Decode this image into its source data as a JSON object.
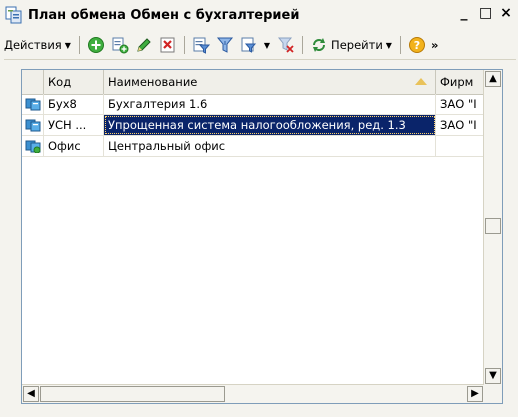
{
  "window": {
    "title": "План обмена Обмен с бухгалтерией",
    "icon": "exchange-plan-icon",
    "controls": {
      "minimize": "_",
      "maximize": "□",
      "close": "×"
    }
  },
  "toolbar": {
    "actions_label": "Действия",
    "goto_label": "Перейти",
    "more_label": "»",
    "icons": [
      "add-icon",
      "copy-icon",
      "edit-icon",
      "delete-icon",
      "filter-icon",
      "filter-by-value-icon",
      "filter-dropdown-icon",
      "clear-filter-icon",
      "refresh-icon",
      "help-icon"
    ]
  },
  "grid": {
    "columns": [
      "Код",
      "Наименование",
      "Фирм"
    ],
    "rows": [
      {
        "code": "Бух8",
        "name": "Бухгалтерия 1.6",
        "firm": "ЗАО \"I",
        "selected": false
      },
      {
        "code": "УСН ...",
        "name": "Упрощенная система налогообложения, ред. 1.3",
        "firm": "ЗАО \"I",
        "selected": true
      },
      {
        "code": "Офис",
        "name": "Центральный офис",
        "firm": "",
        "selected": false
      }
    ]
  },
  "scrollbars": {
    "up": "▲",
    "down": "▼",
    "left": "◀",
    "right": "▶"
  },
  "colors": {
    "selection": "#0a246a",
    "window_bg": "#f4f3ee",
    "grid_border": "#7f9db9"
  }
}
